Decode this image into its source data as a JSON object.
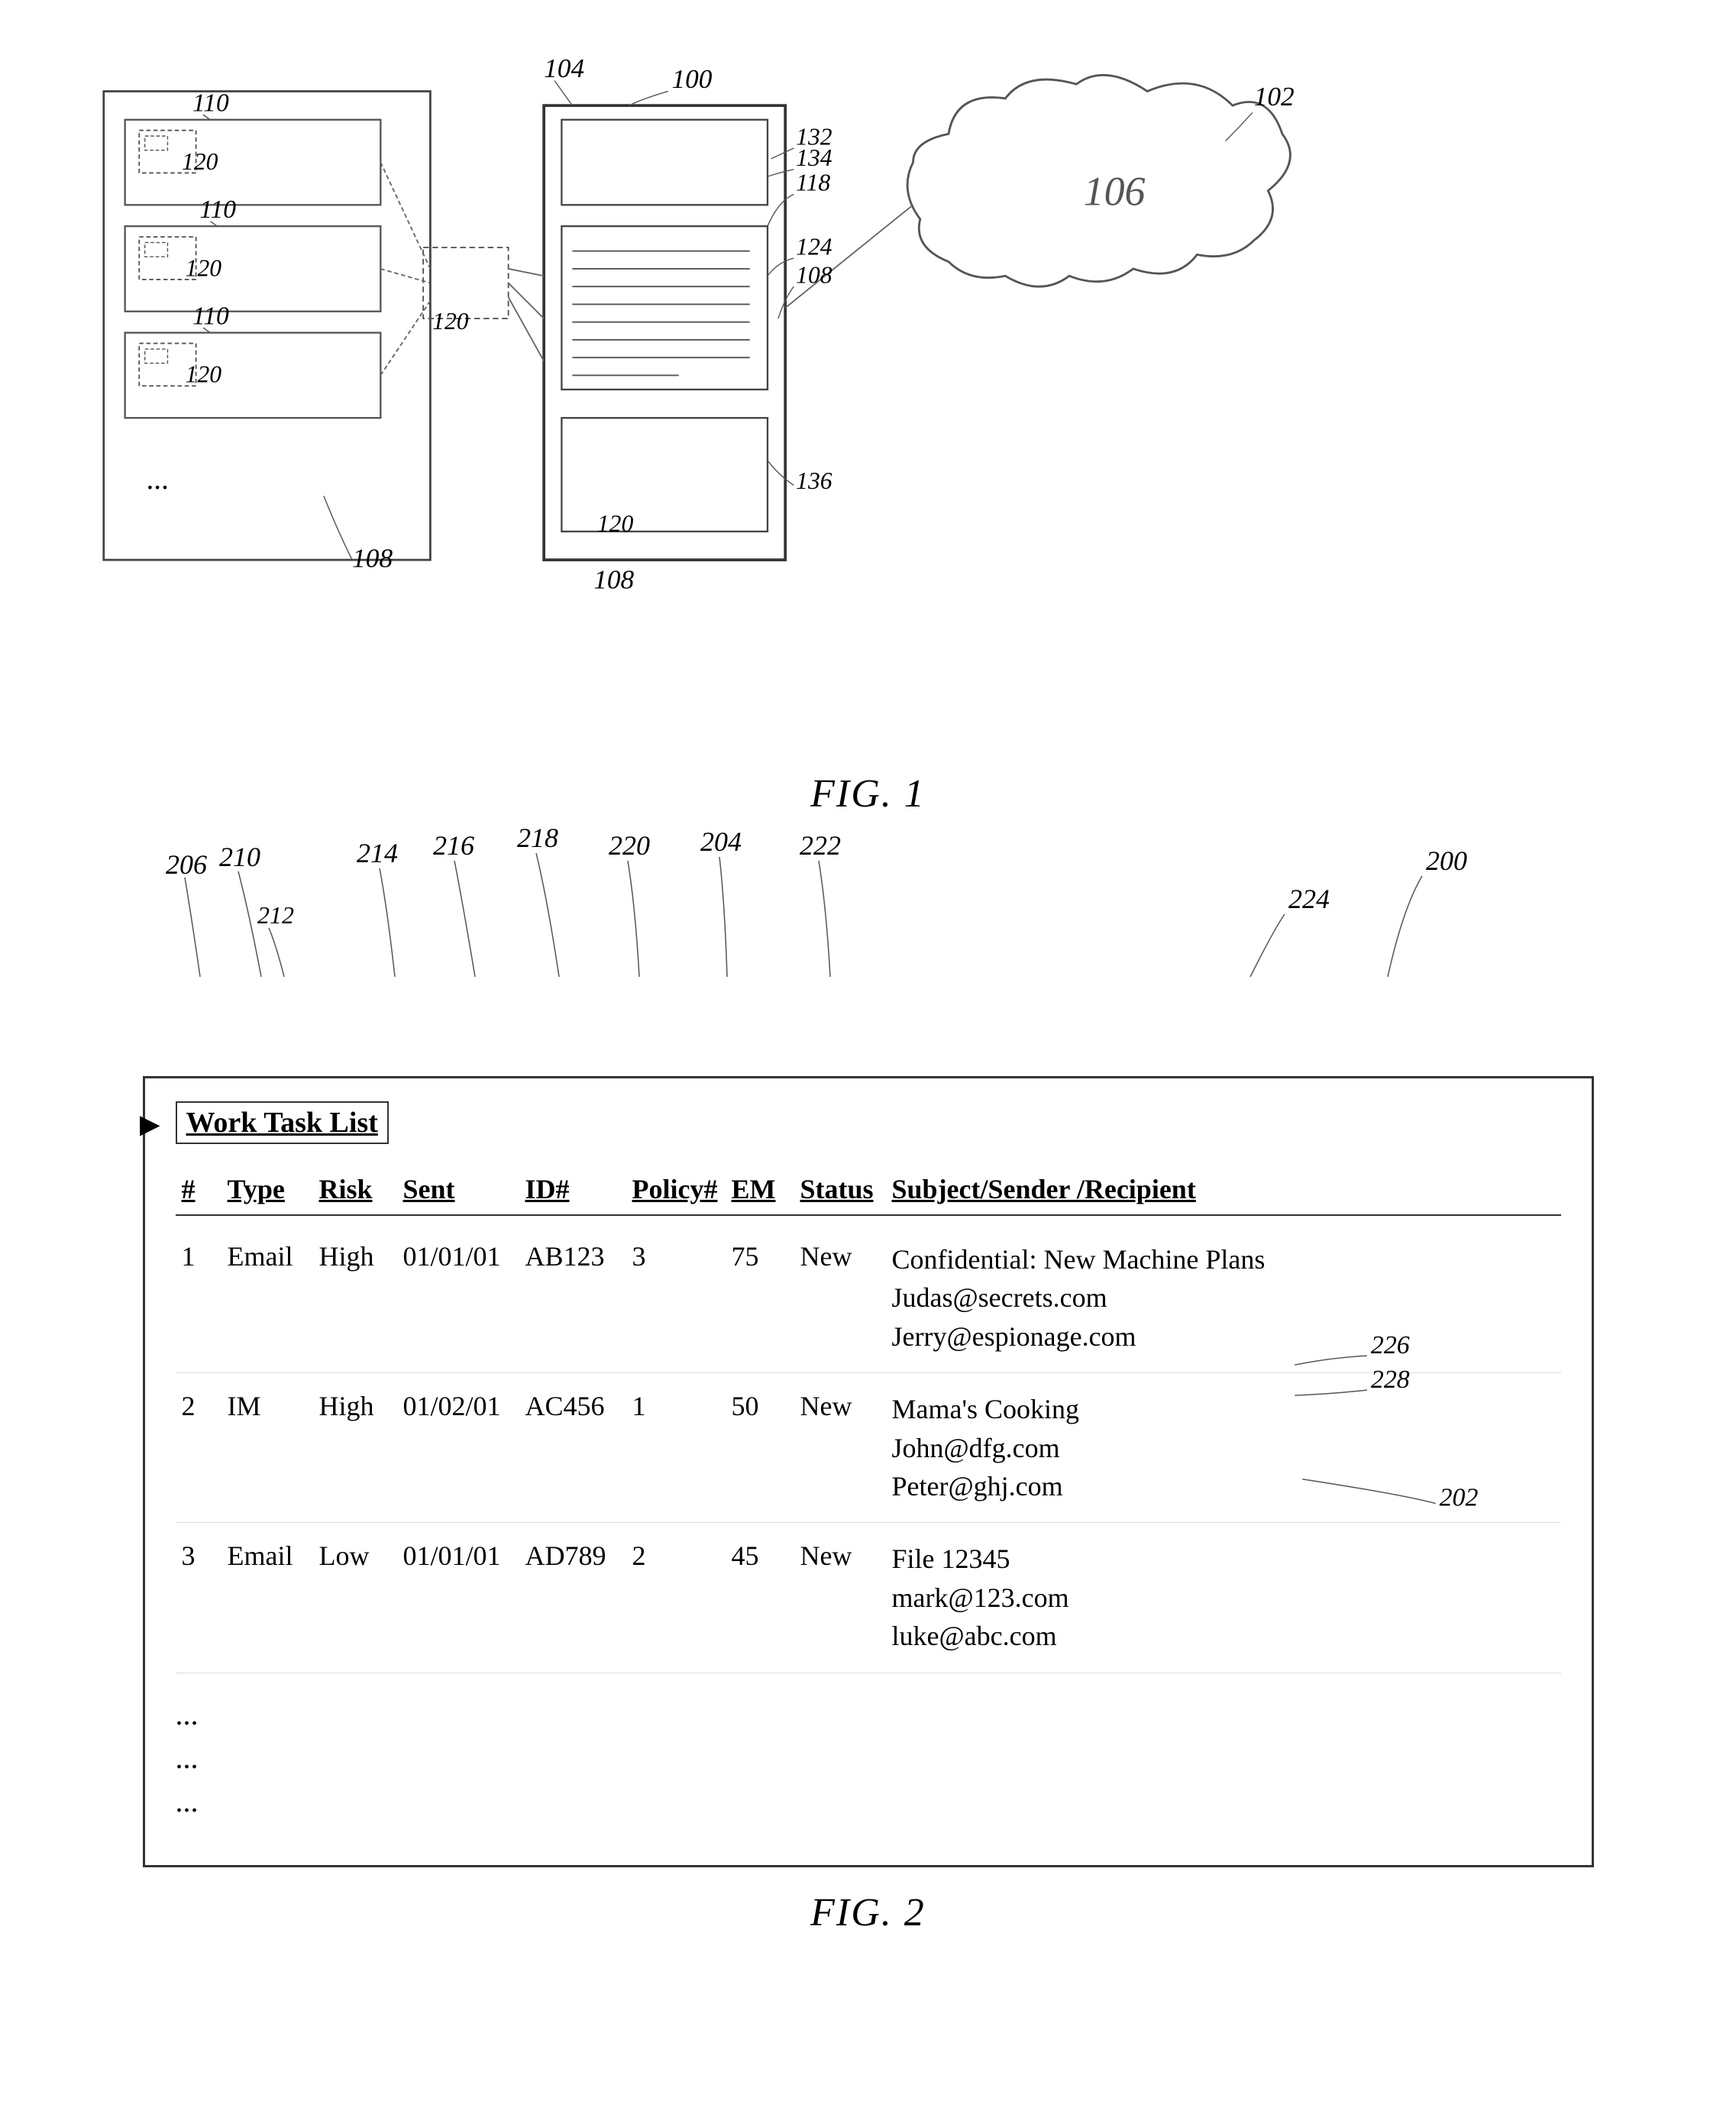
{
  "fig1": {
    "label": "FIG. 1",
    "refs": {
      "r100": "100",
      "r102": "102",
      "r104": "104",
      "r106": "106",
      "r108a": "108",
      "r108b": "108",
      "r108c": "108",
      "r110a": "110",
      "r110b": "110",
      "r110c": "110",
      "r118": "118",
      "r120a": "120",
      "r120b": "120",
      "r120c": "120",
      "r120d": "120",
      "r124": "124",
      "r132": "132",
      "r134": "134",
      "r136": "136"
    },
    "ellipsis": "..."
  },
  "fig2": {
    "label": "FIG. 2",
    "title": "Work Task List",
    "refs": {
      "r200": "200",
      "r202": "202",
      "r204": "204",
      "r206": "206",
      "r210": "210",
      "r212": "212",
      "r214": "214",
      "r216": "216",
      "r218": "218",
      "r220": "220",
      "r222": "222",
      "r224": "224",
      "r226": "226",
      "r228": "228"
    },
    "columns": [
      "#",
      "Type",
      "Risk",
      "Sent",
      "ID#",
      "Policy#",
      "EM",
      "Status",
      "Subject/Sender /Recipient"
    ],
    "rows": [
      {
        "num": "1",
        "type": "Email",
        "risk": "High",
        "sent": "01/01/01",
        "id": "AB123",
        "policy": "3",
        "em": "75",
        "status": "New",
        "subject": "Confidential: New Machine Plans",
        "sender": "Judas@secrets.com",
        "recipient": "Jerry@espionage.com"
      },
      {
        "num": "2",
        "type": "IM",
        "risk": "High",
        "sent": "01/02/01",
        "id": "AC456",
        "policy": "1",
        "em": "50",
        "status": "New",
        "subject": "Mama's Cooking",
        "sender": "John@dfg.com",
        "recipient": "Peter@ghj.com"
      },
      {
        "num": "3",
        "type": "Email",
        "risk": "Low",
        "sent": "01/01/01",
        "id": "AD789",
        "policy": "2",
        "em": "45",
        "status": "New",
        "subject": "File 12345",
        "sender": "mark@123.com",
        "recipient": "luke@abc.com"
      }
    ],
    "ellipsis_rows": [
      "...",
      "...",
      "..."
    ]
  }
}
